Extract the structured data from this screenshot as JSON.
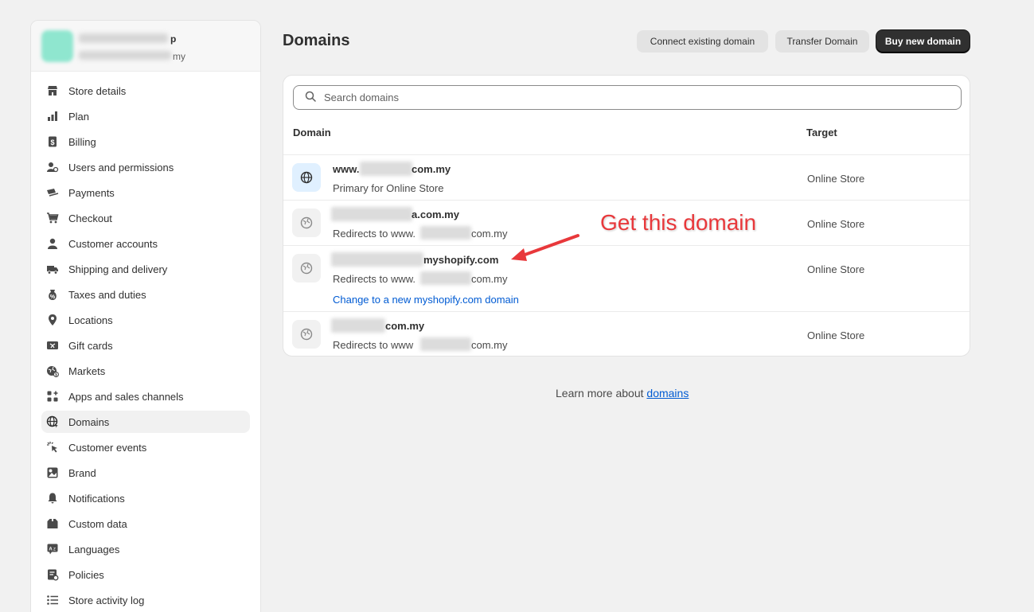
{
  "sidebar": {
    "store_suffix": "my",
    "store_tail": "p",
    "items": [
      {
        "label": "Store details",
        "icon": "store-icon"
      },
      {
        "label": "Plan",
        "icon": "plan-icon"
      },
      {
        "label": "Billing",
        "icon": "billing-icon"
      },
      {
        "label": "Users and permissions",
        "icon": "users-icon"
      },
      {
        "label": "Payments",
        "icon": "payments-icon"
      },
      {
        "label": "Checkout",
        "icon": "cart-icon"
      },
      {
        "label": "Customer accounts",
        "icon": "person-icon"
      },
      {
        "label": "Shipping and delivery",
        "icon": "truck-icon"
      },
      {
        "label": "Taxes and duties",
        "icon": "tax-icon"
      },
      {
        "label": "Locations",
        "icon": "location-pin-icon"
      },
      {
        "label": "Gift cards",
        "icon": "gift-card-icon"
      },
      {
        "label": "Markets",
        "icon": "globe-dollar-icon"
      },
      {
        "label": "Apps and sales channels",
        "icon": "apps-icon"
      },
      {
        "label": "Domains",
        "icon": "globe-icon",
        "active": true
      },
      {
        "label": "Customer events",
        "icon": "cursor-click-icon"
      },
      {
        "label": "Brand",
        "icon": "brand-icon"
      },
      {
        "label": "Notifications",
        "icon": "bell-icon"
      },
      {
        "label": "Custom data",
        "icon": "custom-data-icon"
      },
      {
        "label": "Languages",
        "icon": "language-icon"
      },
      {
        "label": "Policies",
        "icon": "policies-icon"
      },
      {
        "label": "Store activity log",
        "icon": "list-icon"
      }
    ]
  },
  "header": {
    "title": "Domains",
    "connect_label": "Connect existing domain",
    "transfer_label": "Transfer Domain",
    "buy_label": "Buy new domain"
  },
  "search": {
    "placeholder": "Search domains"
  },
  "table": {
    "col_domain": "Domain",
    "col_target": "Target",
    "rows": [
      {
        "name_prefix": "www.",
        "name_suffix": "com.my",
        "sub": "Primary for Online Store",
        "target": "Online Store"
      },
      {
        "name_suffix": "a.com.my",
        "sub_prefix": "Redirects to www.",
        "sub_suffix": "com.my",
        "target": "Online Store"
      },
      {
        "name_suffix": "myshopify.com",
        "sub_prefix": "Redirects to www.",
        "sub_suffix": "com.my",
        "link": "Change to a new myshopify.com domain",
        "target": "Online Store"
      },
      {
        "name_suffix": "com.my",
        "sub_prefix": "Redirects to www",
        "sub_suffix": "com.my",
        "target": "Online Store"
      }
    ]
  },
  "footer": {
    "learn_prefix": "Learn more about ",
    "learn_link": "domains"
  },
  "annotation": {
    "text": "Get this domain",
    "color": "#e8383b"
  },
  "colors": {
    "primary_button": "#303030",
    "link": "#005bd3",
    "background": "#f1f1f1"
  }
}
